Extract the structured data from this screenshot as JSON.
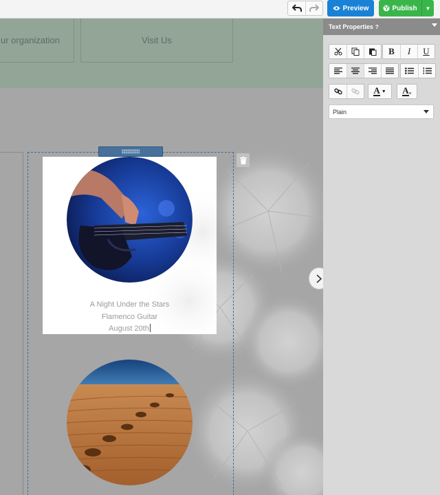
{
  "toolbar": {
    "preview_label": "Preview",
    "publish_label": "Publish"
  },
  "site_nav": {
    "items": [
      "ur organization",
      "Visit Us"
    ]
  },
  "event_card": {
    "line1": "A Night Under the Stars",
    "line2": "Flamenco Guitar",
    "line3": "August 20th"
  },
  "text_panel": {
    "title": "Text Properties",
    "help_icon": "?",
    "style_value": "Plain",
    "buttons": [
      "cut-icon",
      "copy-icon",
      "paste-icon",
      "bold",
      "italic",
      "underline",
      "align-left-icon",
      "align-center-icon",
      "align-right-icon",
      "justify-icon",
      "bullet-list-icon",
      "numbered-list-icon",
      "link-icon",
      "unlink-icon",
      "font-color-icon",
      "clear-format-icon"
    ],
    "bold_glyph": "B",
    "italic_glyph": "I",
    "underline_glyph": "U",
    "font_color_glyph": "A",
    "clear_format_glyph": "A"
  },
  "colors": {
    "preview": "#1a82d6",
    "publish": "#3ab54a",
    "selection": "#3d6a96",
    "panel_header": "#8b8b8b"
  }
}
